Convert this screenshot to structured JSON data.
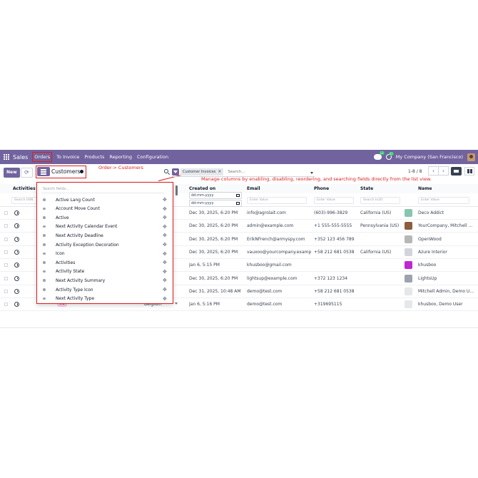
{
  "navbar": {
    "app_name": "Sales",
    "menu": [
      "Orders",
      "To Invoice",
      "Products",
      "Reporting",
      "Configuration"
    ],
    "chat_badge": "12",
    "activity_badge": "41",
    "company": "My Company (San Francisco)"
  },
  "control": {
    "new_label": "New",
    "breadcrumb": "Customers",
    "annotation_1": "Order-> Customers",
    "annotation_2": "Manage columns by enabling, disabling, reordering, and searching fields directly from the list view.",
    "facet": "Customer Invoices",
    "search_placeholder": "Search...",
    "pager": "1-8 / 8"
  },
  "columns": {
    "activities": "Activities",
    "created_on": "Created on",
    "email": "Email",
    "phone": "Phone",
    "state": "State",
    "name": "Name"
  },
  "filters": {
    "activities": "Search USN",
    "date_placeholder": "dd-mm-yyyy",
    "email": "Enter Value",
    "phone": "Enter Value",
    "state": "Search In2O",
    "name": "Enter Value"
  },
  "rows": [
    {
      "created": "Dec 30, 2025, 6:20 PM",
      "email": "info@agrolait.com",
      "phone": "(603)-996-3829",
      "state": "California (US)",
      "name": "Deco Addict",
      "logo_color": "#86c5b0"
    },
    {
      "created": "Dec 30, 2025, 6:20 PM",
      "email": "admin@example.com",
      "phone": "+1 555-555-5555",
      "state": "Pennsylvania (US)",
      "name": "YourCompany, Mitchell ...",
      "logo_color": "#8b5e3c"
    },
    {
      "created": "Dec 30, 2025, 6:20 PM",
      "email": "ErikNFrench@armyspy.com",
      "phone": "+352 123 456 789",
      "state": "",
      "name": "OpenWood",
      "logo_color": "#b7b7b7"
    },
    {
      "created": "Dec 30, 2025, 6:20 PM",
      "email": "vauxoo@yourcompany.exampl...",
      "phone": "+58 212 681 0538",
      "state": "California (US)",
      "name": "Azure Interior",
      "logo_color": "#d1d5db"
    },
    {
      "created": "Jan 6, 5:15 PM",
      "email": "khusboo@gmail.com",
      "phone": "",
      "state": "",
      "name": "khusboo",
      "logo_color": "#c026d3"
    },
    {
      "created": "Dec 30, 2025, 6:20 PM",
      "email": "lightsup@example.com",
      "phone": "+372 123 1234",
      "state": "",
      "name": "LightsUp",
      "logo_color": "#9ca3af"
    },
    {
      "created": "Dec 31, 2025, 10:48 AM",
      "email": "demo@test.com",
      "phone": "+58 212 681 0538",
      "state": "",
      "name": "Mitchell Admin, Demo U...",
      "logo_color": "#e5e7eb"
    },
    {
      "created": "Jan 6, 5:16 PM",
      "email": "demo@test.com",
      "phone": "+319695115",
      "state": "",
      "name": "khusboo, Demo User",
      "logo_color": "#e5e7eb"
    }
  ],
  "last_row_country": "Belgium",
  "dropdown": {
    "search_placeholder": "Search fields...",
    "fields": [
      "Active Lang Count",
      "Account Move Count",
      "Active",
      "Next Activity Calendar Event",
      "Next Activity Deadline",
      "Activity Exception Decoration",
      "Icon",
      "Activities",
      "Activity State",
      "Next Activity Summary",
      "Activity Type Icon",
      "Next Activity Type"
    ]
  },
  "colors": {
    "brand": "#71639e",
    "annotation": "#e11d1d"
  }
}
